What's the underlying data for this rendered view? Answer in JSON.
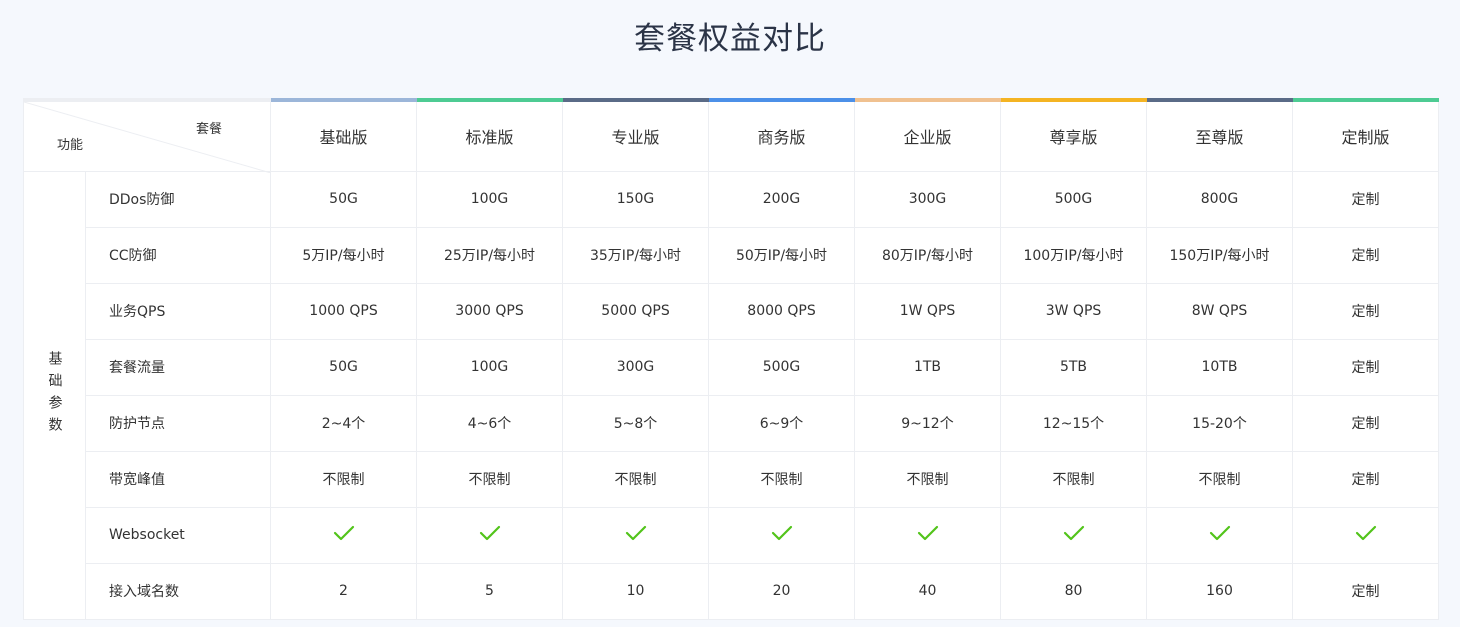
{
  "title": "套餐权益对比",
  "header": {
    "corner_top": "套餐",
    "corner_bottom": "功能",
    "plans": [
      {
        "name": "基础版",
        "color": "#9cb6d9"
      },
      {
        "name": "标准版",
        "color": "#4ecb93"
      },
      {
        "name": "专业版",
        "color": "#5a6b87"
      },
      {
        "name": "商务版",
        "color": "#4c90e8"
      },
      {
        "name": "企业版",
        "color": "#f0c190"
      },
      {
        "name": "尊享版",
        "color": "#f4b423"
      },
      {
        "name": "至尊版",
        "color": "#5a6b87"
      },
      {
        "name": "定制版",
        "color": "#4ecb93"
      }
    ]
  },
  "group": {
    "label": "基础参数"
  },
  "rows": [
    {
      "feature": "DDos防御",
      "values": [
        "50G",
        "100G",
        "150G",
        "200G",
        "300G",
        "500G",
        "800G",
        "定制"
      ]
    },
    {
      "feature": "CC防御",
      "values": [
        "5万IP/每小时",
        "25万IP/每小时",
        "35万IP/每小时",
        "50万IP/每小时",
        "80万IP/每小时",
        "100万IP/每小时",
        "150万IP/每小时",
        "定制"
      ]
    },
    {
      "feature": "业务QPS",
      "values": [
        "1000 QPS",
        "3000 QPS",
        "5000 QPS",
        "8000 QPS",
        "1W QPS",
        "3W QPS",
        "8W QPS",
        "定制"
      ]
    },
    {
      "feature": "套餐流量",
      "values": [
        "50G",
        "100G",
        "300G",
        "500G",
        "1TB",
        "5TB",
        "10TB",
        "定制"
      ]
    },
    {
      "feature": "防护节点",
      "values": [
        "2~4个",
        "4~6个",
        "5~8个",
        "6~9个",
        "9~12个",
        "12~15个",
        "15-20个",
        "定制"
      ]
    },
    {
      "feature": "带宽峰值",
      "values": [
        "不限制",
        "不限制",
        "不限制",
        "不限制",
        "不限制",
        "不限制",
        "不限制",
        "定制"
      ]
    },
    {
      "feature": "Websocket",
      "check": true,
      "values": [
        "",
        "",
        "",
        "",
        "",
        "",
        "",
        ""
      ]
    },
    {
      "feature": "接入域名数",
      "values": [
        "2",
        "5",
        "10",
        "20",
        "40",
        "80",
        "160",
        "定制"
      ]
    }
  ],
  "colors": {
    "check": "#52c41a"
  },
  "icons": {
    "check": "check-icon"
  }
}
